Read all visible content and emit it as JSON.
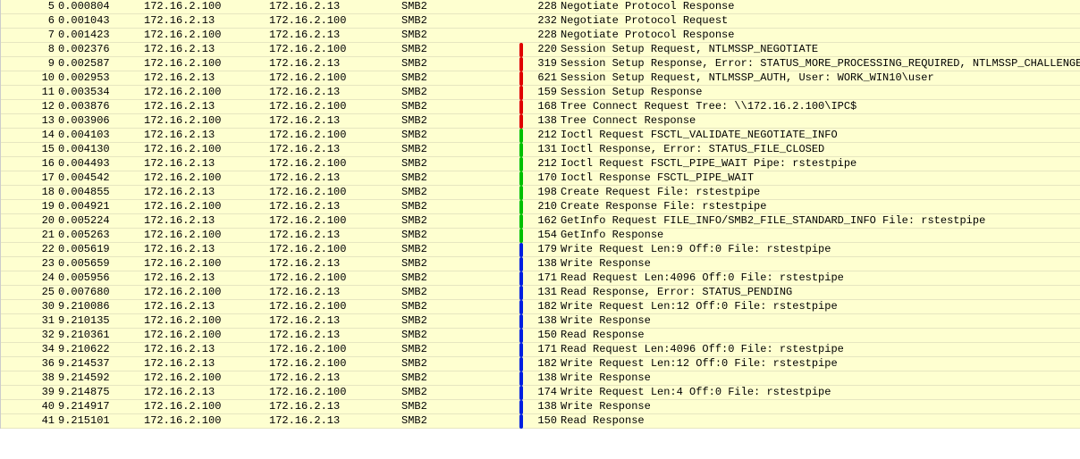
{
  "ips": {
    "client": "172.16.2.13",
    "server": "172.16.2.100"
  },
  "protocol": "SMB2",
  "brackets": {
    "red": {
      "color": "#e00000"
    },
    "green": {
      "color": "#00c000"
    },
    "blue": {
      "color": "#0020e0"
    }
  },
  "rows": [
    {
      "no": 5,
      "time": "0.000804",
      "src": "172.16.2.100",
      "dst": "172.16.2.13",
      "proto": "SMB2",
      "bracket": "",
      "len": 228,
      "info": "Negotiate Protocol Response"
    },
    {
      "no": 6,
      "time": "0.001043",
      "src": "172.16.2.13",
      "dst": "172.16.2.100",
      "proto": "SMB2",
      "bracket": "",
      "len": 232,
      "info": "Negotiate Protocol Request"
    },
    {
      "no": 7,
      "time": "0.001423",
      "src": "172.16.2.100",
      "dst": "172.16.2.13",
      "proto": "SMB2",
      "bracket": "",
      "len": 228,
      "info": "Negotiate Protocol Response"
    },
    {
      "no": 8,
      "time": "0.002376",
      "src": "172.16.2.13",
      "dst": "172.16.2.100",
      "proto": "SMB2",
      "bracket": "red",
      "len": 220,
      "info": "Session Setup Request, NTLMSSP_NEGOTIATE"
    },
    {
      "no": 9,
      "time": "0.002587",
      "src": "172.16.2.100",
      "dst": "172.16.2.13",
      "proto": "SMB2",
      "bracket": "red",
      "len": 319,
      "info": "Session Setup Response, Error: STATUS_MORE_PROCESSING_REQUIRED, NTLMSSP_CHALLENGE"
    },
    {
      "no": 10,
      "time": "0.002953",
      "src": "172.16.2.13",
      "dst": "172.16.2.100",
      "proto": "SMB2",
      "bracket": "red",
      "len": 621,
      "info": "Session Setup Request, NTLMSSP_AUTH, User: WORK_WIN10\\user"
    },
    {
      "no": 11,
      "time": "0.003534",
      "src": "172.16.2.100",
      "dst": "172.16.2.13",
      "proto": "SMB2",
      "bracket": "red",
      "len": 159,
      "info": "Session Setup Response"
    },
    {
      "no": 12,
      "time": "0.003876",
      "src": "172.16.2.13",
      "dst": "172.16.2.100",
      "proto": "SMB2",
      "bracket": "red",
      "len": 168,
      "info": "Tree Connect Request Tree: \\\\172.16.2.100\\IPC$"
    },
    {
      "no": 13,
      "time": "0.003906",
      "src": "172.16.2.100",
      "dst": "172.16.2.13",
      "proto": "SMB2",
      "bracket": "red",
      "len": 138,
      "info": "Tree Connect Response"
    },
    {
      "no": 14,
      "time": "0.004103",
      "src": "172.16.2.13",
      "dst": "172.16.2.100",
      "proto": "SMB2",
      "bracket": "green",
      "len": 212,
      "info": "Ioctl Request FSCTL_VALIDATE_NEGOTIATE_INFO"
    },
    {
      "no": 15,
      "time": "0.004130",
      "src": "172.16.2.100",
      "dst": "172.16.2.13",
      "proto": "SMB2",
      "bracket": "green",
      "len": 131,
      "info": "Ioctl Response, Error: STATUS_FILE_CLOSED"
    },
    {
      "no": 16,
      "time": "0.004493",
      "src": "172.16.2.13",
      "dst": "172.16.2.100",
      "proto": "SMB2",
      "bracket": "green",
      "len": 212,
      "info": "Ioctl Request FSCTL_PIPE_WAIT Pipe: rstestpipe"
    },
    {
      "no": 17,
      "time": "0.004542",
      "src": "172.16.2.100",
      "dst": "172.16.2.13",
      "proto": "SMB2",
      "bracket": "green",
      "len": 170,
      "info": "Ioctl Response FSCTL_PIPE_WAIT"
    },
    {
      "no": 18,
      "time": "0.004855",
      "src": "172.16.2.13",
      "dst": "172.16.2.100",
      "proto": "SMB2",
      "bracket": "green",
      "len": 198,
      "info": "Create Request File: rstestpipe"
    },
    {
      "no": 19,
      "time": "0.004921",
      "src": "172.16.2.100",
      "dst": "172.16.2.13",
      "proto": "SMB2",
      "bracket": "green",
      "len": 210,
      "info": "Create Response File: rstestpipe"
    },
    {
      "no": 20,
      "time": "0.005224",
      "src": "172.16.2.13",
      "dst": "172.16.2.100",
      "proto": "SMB2",
      "bracket": "green",
      "len": 162,
      "info": "GetInfo Request FILE_INFO/SMB2_FILE_STANDARD_INFO File: rstestpipe"
    },
    {
      "no": 21,
      "time": "0.005263",
      "src": "172.16.2.100",
      "dst": "172.16.2.13",
      "proto": "SMB2",
      "bracket": "green",
      "len": 154,
      "info": "GetInfo Response"
    },
    {
      "no": 22,
      "time": "0.005619",
      "src": "172.16.2.13",
      "dst": "172.16.2.100",
      "proto": "SMB2",
      "bracket": "blue",
      "len": 179,
      "info": "Write Request Len:9 Off:0 File: rstestpipe"
    },
    {
      "no": 23,
      "time": "0.005659",
      "src": "172.16.2.100",
      "dst": "172.16.2.13",
      "proto": "SMB2",
      "bracket": "blue",
      "len": 138,
      "info": "Write Response"
    },
    {
      "no": 24,
      "time": "0.005956",
      "src": "172.16.2.13",
      "dst": "172.16.2.100",
      "proto": "SMB2",
      "bracket": "blue",
      "len": 171,
      "info": "Read Request Len:4096 Off:0 File: rstestpipe"
    },
    {
      "no": 25,
      "time": "0.007680",
      "src": "172.16.2.100",
      "dst": "172.16.2.13",
      "proto": "SMB2",
      "bracket": "blue",
      "len": 131,
      "info": "Read Response, Error: STATUS_PENDING"
    },
    {
      "no": 30,
      "time": "9.210086",
      "src": "172.16.2.13",
      "dst": "172.16.2.100",
      "proto": "SMB2",
      "bracket": "blue",
      "len": 182,
      "info": "Write Request Len:12 Off:0 File: rstestpipe"
    },
    {
      "no": 31,
      "time": "9.210135",
      "src": "172.16.2.100",
      "dst": "172.16.2.13",
      "proto": "SMB2",
      "bracket": "blue",
      "len": 138,
      "info": "Write Response"
    },
    {
      "no": 32,
      "time": "9.210361",
      "src": "172.16.2.100",
      "dst": "172.16.2.13",
      "proto": "SMB2",
      "bracket": "blue",
      "len": 150,
      "info": "Read Response"
    },
    {
      "no": 34,
      "time": "9.210622",
      "src": "172.16.2.13",
      "dst": "172.16.2.100",
      "proto": "SMB2",
      "bracket": "blue",
      "len": 171,
      "info": "Read Request Len:4096 Off:0 File: rstestpipe"
    },
    {
      "no": 36,
      "time": "9.214537",
      "src": "172.16.2.13",
      "dst": "172.16.2.100",
      "proto": "SMB2",
      "bracket": "blue",
      "len": 182,
      "info": "Write Request Len:12 Off:0 File: rstestpipe"
    },
    {
      "no": 38,
      "time": "9.214592",
      "src": "172.16.2.100",
      "dst": "172.16.2.13",
      "proto": "SMB2",
      "bracket": "blue",
      "len": 138,
      "info": "Write Response"
    },
    {
      "no": 39,
      "time": "9.214875",
      "src": "172.16.2.13",
      "dst": "172.16.2.100",
      "proto": "SMB2",
      "bracket": "blue",
      "len": 174,
      "info": "Write Request Len:4 Off:0 File: rstestpipe"
    },
    {
      "no": 40,
      "time": "9.214917",
      "src": "172.16.2.100",
      "dst": "172.16.2.13",
      "proto": "SMB2",
      "bracket": "blue",
      "len": 138,
      "info": "Write Response"
    },
    {
      "no": 41,
      "time": "9.215101",
      "src": "172.16.2.100",
      "dst": "172.16.2.13",
      "proto": "SMB2",
      "bracket": "blue",
      "len": 150,
      "info": "Read Response"
    }
  ]
}
